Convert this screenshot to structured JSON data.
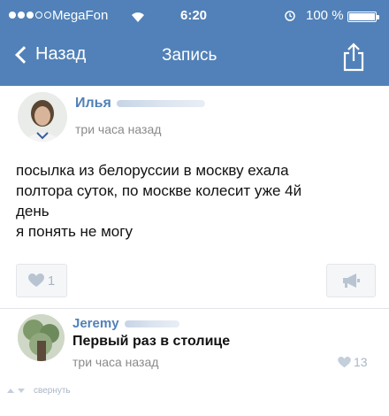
{
  "status_bar": {
    "carrier": "MegaFon",
    "time": "6:20",
    "battery_percent": "100 %",
    "battery_level": 1.0,
    "signal_strength": 3
  },
  "nav": {
    "back_label": "Назад",
    "title": "Запись",
    "share_icon": "share-icon"
  },
  "post": {
    "author": "Илья",
    "time": "три часа назад",
    "text_lines": [
      "посылка из белоруссии в москву ехала",
      "полтора суток, по москве колесит уже 4й",
      "день",
      "я понять не могу"
    ],
    "likes": "1",
    "like_icon": "heart-icon",
    "repost_icon": "megaphone-icon"
  },
  "comment": {
    "author": "Jeremy",
    "text": "Первый раз в столице",
    "time": "три часа назад",
    "likes": "13"
  },
  "footer": {
    "collapse_label": "свернуть"
  },
  "colors": {
    "header_bg": "#5181b8",
    "link": "#5181b8",
    "muted": "#8a8a8a"
  }
}
